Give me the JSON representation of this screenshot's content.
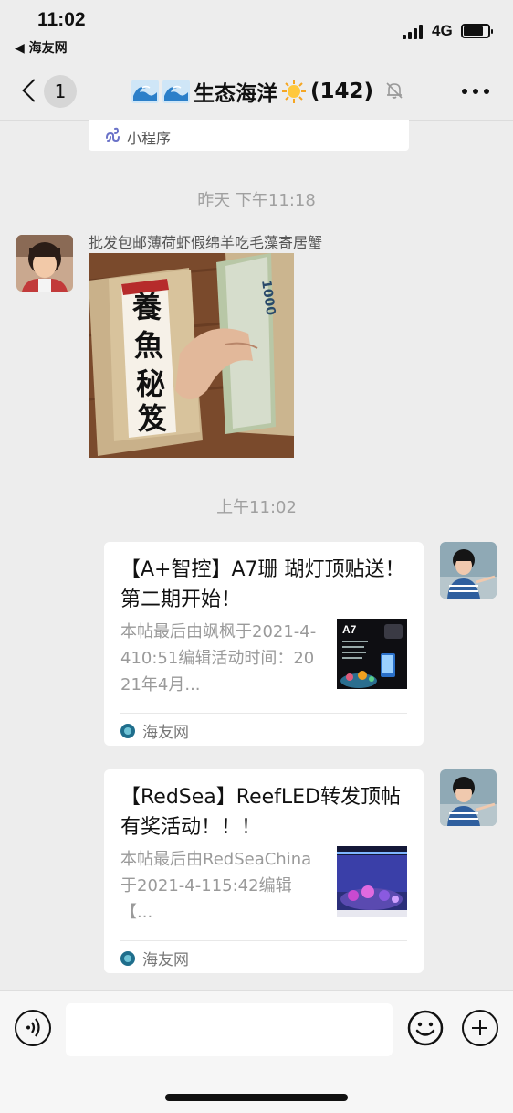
{
  "status_bar": {
    "time": "11:02",
    "back_app": "◀ 海友网",
    "network": "4G"
  },
  "nav": {
    "badge_count": "1",
    "title": "生态海洋",
    "member_count": "(142)",
    "icons": [
      "back-icon",
      "wave-emoji-icon",
      "sun-emoji-icon",
      "mute-bell-icon",
      "more-icon"
    ]
  },
  "messages": {
    "mini_program_label": "小程序",
    "ts_yesterday": "昨天 下午11:18",
    "incoming_sender_text": "批发包邮薄荷虾假绵羊吃毛藻寄居蟹",
    "photo_book_text": "養魚秘笈",
    "photo_banknote": "1000",
    "ts_today": "上午11:02",
    "card1": {
      "title": "【A+智控】A7珊 瑚灯顶贴送！第二期开始！",
      "desc": "本帖最后由飒枫于2021-4-410:51编辑活动时间：2021年4月...",
      "thumb_label": "A7",
      "source": "海友网"
    },
    "card2": {
      "title": "【RedSea】ReefLED转发顶帖有奖活动！！！",
      "desc": "本帖最后由RedSeaChina于2021-4-115:42编辑【...",
      "source": "海友网"
    }
  },
  "input_bar": {
    "icons": [
      "voice-icon",
      "emoji-icon",
      "plus-icon"
    ],
    "field_value": ""
  },
  "colors": {
    "background": "#ededed",
    "card": "#ffffff",
    "timestamp": "#a0a0a0"
  }
}
